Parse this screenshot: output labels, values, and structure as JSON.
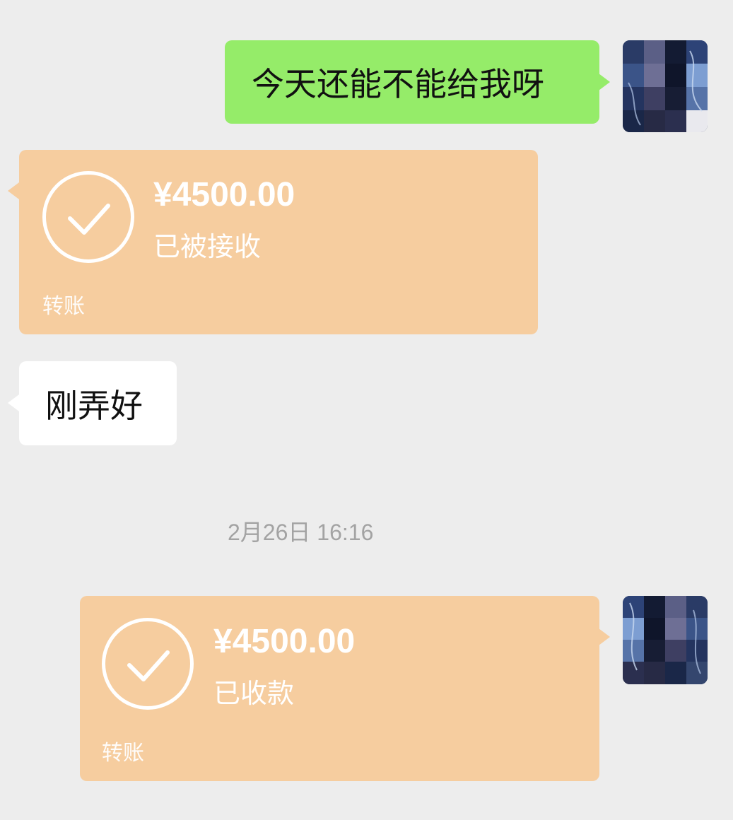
{
  "chat": {
    "messages": [
      {
        "type": "text",
        "side": "right",
        "text": "今天还能不能给我呀",
        "bubble_color": "#95ec69"
      },
      {
        "type": "transfer",
        "side": "left",
        "amount": "¥4500.00",
        "status": "已被接收",
        "label": "转账",
        "icon": "check-icon",
        "bubble_color": "#f6cd9f"
      },
      {
        "type": "text",
        "side": "left",
        "text": "刚弄好",
        "bubble_color": "#ffffff"
      },
      {
        "type": "timestamp",
        "text": "2月26日 16:16"
      },
      {
        "type": "transfer",
        "side": "right",
        "amount": "¥4500.00",
        "status": "已收款",
        "label": "转账",
        "icon": "check-icon",
        "bubble_color": "#f6cd9f"
      }
    ]
  },
  "colors": {
    "background": "#ededed",
    "sent_text_bubble": "#95ec69",
    "received_text_bubble": "#ffffff",
    "transfer_bubble": "#f6cd9f",
    "timestamp_text": "#a3a3a3"
  }
}
